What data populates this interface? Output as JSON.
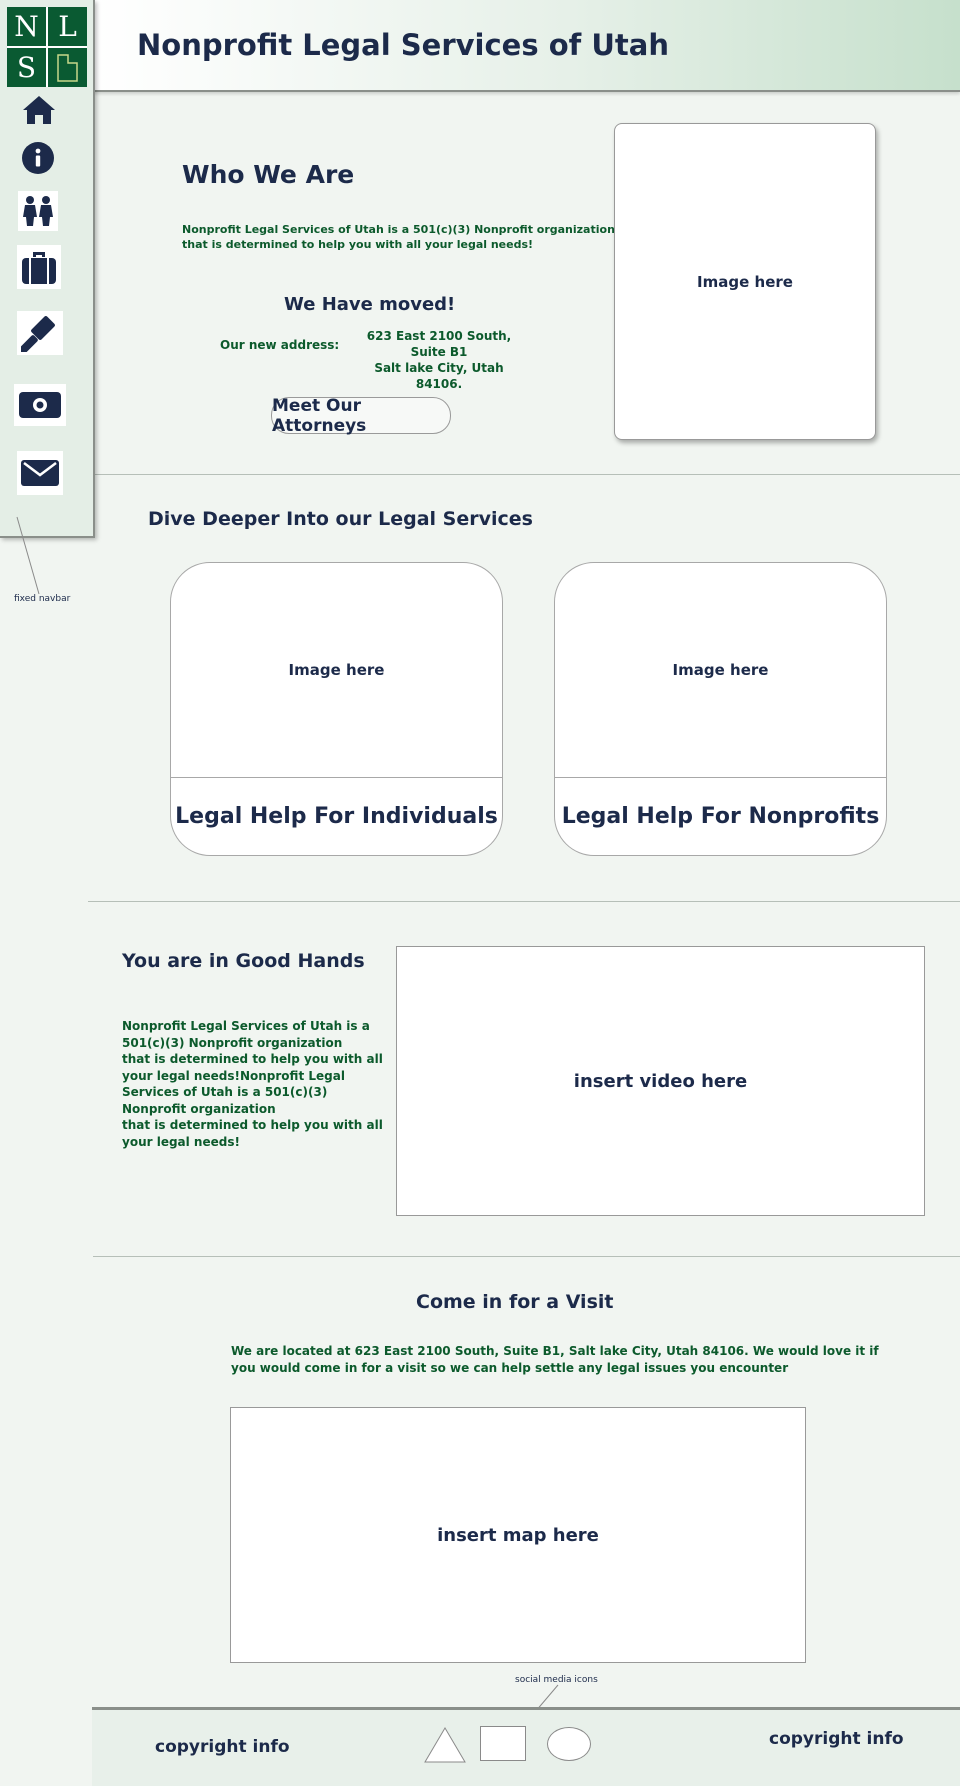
{
  "header": {
    "title": "Nonprofit Legal Services of Utah"
  },
  "logo": {
    "letters": [
      "N",
      "L",
      "S"
    ]
  },
  "nav": {
    "icons": [
      "home-icon",
      "info-icon",
      "people-icon",
      "briefcase-icon",
      "gavel-icon",
      "money-icon",
      "envelope-icon"
    ],
    "annotation": "fixed navbar"
  },
  "who_we_are": {
    "title": "Who We Are",
    "body": [
      "Nonprofit Legal Services of Utah is a 501(c)(3) Nonprofit organization",
      "that is determined to help you with all your legal needs!"
    ],
    "moved_title": "We Have moved!",
    "address_label": "Our new address:",
    "address": [
      "623 East 2100 South, Suite B1",
      "Salt lake City, Utah 84106."
    ],
    "button": "Meet Our Attorneys",
    "image": "Image here"
  },
  "services": {
    "title": "Dive Deeper Into our Legal Services",
    "cards": [
      {
        "image": "Image here",
        "label": "Legal Help For Individuals"
      },
      {
        "image": "Image here",
        "label": "Legal Help For Nonprofits"
      }
    ]
  },
  "good_hands": {
    "title": "You are in Good Hands",
    "body": [
      "Nonprofit Legal Services of Utah is a",
      "501(c)(3) Nonprofit organization",
      "that is determined to help you with all",
      "your legal needs!Nonprofit Legal",
      "Services of Utah is a 501(c)(3)",
      "Nonprofit organization",
      "that is determined to help you with all",
      "your legal needs!"
    ],
    "video": "insert video here"
  },
  "visit": {
    "title": "Come in for a Visit",
    "body": [
      "We are located at 623 East 2100 South, Suite B1, Salt lake City, Utah 84106. We would love it if",
      "you would come in for a visit so we can help settle any legal issues you encounter"
    ],
    "map": "insert map here",
    "social_annotation": "social media icons"
  },
  "footer": {
    "left": "copyright info",
    "right": "copyright info",
    "social_shapes": [
      "triangle",
      "square",
      "circle"
    ]
  },
  "colors": {
    "navy": "#1c2a4a",
    "green": "#0a5a32",
    "text_green": "#0c5a2c",
    "background": "#f1f5f1"
  }
}
